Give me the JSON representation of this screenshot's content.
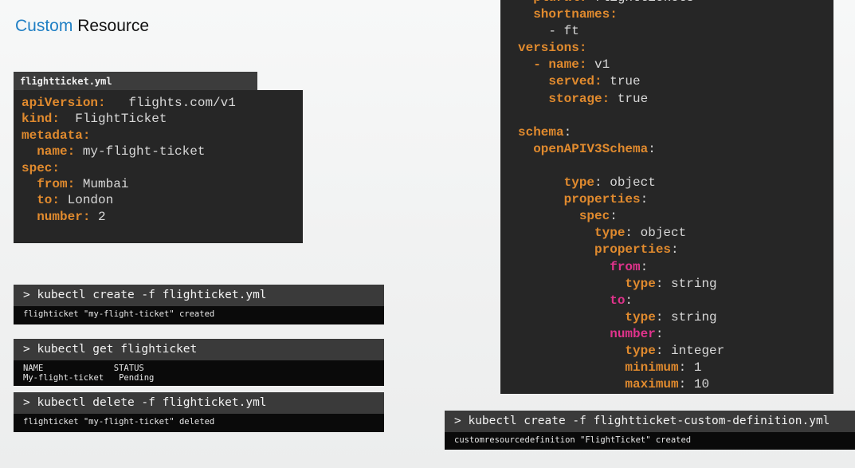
{
  "slide": {
    "title_accent": "Custom",
    "title_rest": " Resource"
  },
  "flight_file": {
    "tab_label": "flightticket.yml",
    "lines": [
      {
        "key": "apiVersion:",
        "value": "   flights.com/v1"
      },
      {
        "key": "kind:",
        "value": "  FlightTicket"
      },
      {
        "key": "metadata:",
        "value": ""
      },
      {
        "key": "  name:",
        "value": " my-flight-ticket"
      },
      {
        "key": "spec:",
        "value": ""
      },
      {
        "key": "  from:",
        "value": " Mumbai"
      },
      {
        "key": "  to:",
        "value": " London"
      },
      {
        "key": "  number:",
        "value": " 2"
      }
    ]
  },
  "terminals": [
    {
      "command": "> kubectl create -f flighticket.yml",
      "output": "flighticket \"my-flight-ticket\" created"
    },
    {
      "command": "> kubectl get flighticket",
      "output": "NAME              STATUS\nMy-flight-ticket   Pending"
    },
    {
      "command": "> kubectl delete -f flighticket.yml",
      "output": "flighticket \"my-flight-ticket\" deleted"
    }
  ],
  "crd_file": {
    "lines": [
      {
        "indent": "  ",
        "key": "plural:",
        "value": " flighttickets"
      },
      {
        "indent": "  ",
        "key": "shortnames:",
        "value": ""
      },
      {
        "indent": "    ",
        "key": "",
        "value": "- ft"
      },
      {
        "indent": "",
        "key": "versions:",
        "value": ""
      },
      {
        "indent": "  ",
        "key": "- name:",
        "value": " v1"
      },
      {
        "indent": "    ",
        "key": "served:",
        "value": " true"
      },
      {
        "indent": "    ",
        "key": "storage:",
        "value": " true"
      },
      {
        "indent": "",
        "key": "",
        "value": ""
      },
      {
        "indent": "",
        "key": "schema",
        "value": ":"
      },
      {
        "indent": "  ",
        "key": "openAPIV3Schema",
        "value": ":"
      },
      {
        "indent": "",
        "key": "",
        "value": ""
      },
      {
        "indent": "      ",
        "key": "type",
        "value": ": object"
      },
      {
        "indent": "      ",
        "key": "properties",
        "value": ":"
      },
      {
        "indent": "        ",
        "key": "spec",
        "value": ":"
      },
      {
        "indent": "          ",
        "key": "type",
        "value": ": object"
      },
      {
        "indent": "          ",
        "key": "properties",
        "value": ":"
      },
      {
        "indent": "            ",
        "key": "from",
        "value": ":",
        "pink": true
      },
      {
        "indent": "              ",
        "key": "type",
        "value": ": string"
      },
      {
        "indent": "            ",
        "key": "to",
        "value": ":",
        "pink": true
      },
      {
        "indent": "              ",
        "key": "type",
        "value": ": string"
      },
      {
        "indent": "            ",
        "key": "number",
        "value": ":",
        "pink": true
      },
      {
        "indent": "              ",
        "key": "type",
        "value": ": integer"
      },
      {
        "indent": "              ",
        "key": "minimum",
        "value": ": 1"
      },
      {
        "indent": "              ",
        "key": "maximum",
        "value": ": 10"
      }
    ]
  },
  "crd_terminal": {
    "command": "> kubectl create -f flightticket-custom-definition.yml",
    "output": "customresourcedefinition \"FlightTicket\" created"
  },
  "colors": {
    "accent": "#1f7fc4",
    "yaml_key": "#e08a2e",
    "yaml_highlight_key": "#e0338c",
    "code_bg": "#262626"
  }
}
